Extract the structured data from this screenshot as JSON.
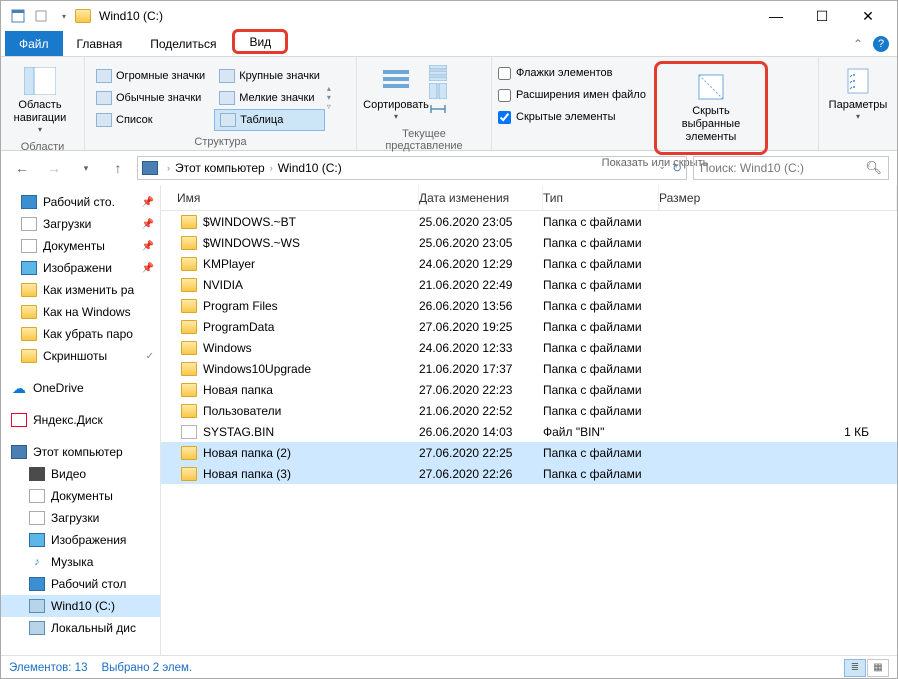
{
  "title": "Wind10 (C:)",
  "tabs": {
    "file": "Файл",
    "home": "Главная",
    "share": "Поделиться",
    "view": "Вид"
  },
  "ribbon": {
    "panes_btn": "Область навигации",
    "panes_group": "Области",
    "layout": {
      "huge": "Огромные значки",
      "large": "Крупные значки",
      "normal": "Обычные значки",
      "small": "Мелкие значки",
      "list": "Список",
      "details": "Таблица"
    },
    "layout_group": "Структура",
    "sort_btn": "Сортировать",
    "view_group": "Текущее представление",
    "chk_boxes": "Флажки элементов",
    "chk_ext": "Расширения имен файло",
    "chk_hidden": "Скрытые элементы",
    "hide_btn": "Скрыть выбранные элементы",
    "show_group": "Показать или скрыть",
    "options_btn": "Параметры"
  },
  "breadcrumb": {
    "pc": "Этот компьютер",
    "drive": "Wind10 (C:)"
  },
  "search_placeholder": "Поиск: Wind10 (C:)",
  "nav": {
    "qa": [
      {
        "label": "Рабочий сто.",
        "icon": "desk",
        "pin": true
      },
      {
        "label": "Загрузки",
        "icon": "dl",
        "pin": true
      },
      {
        "label": "Документы",
        "icon": "doc",
        "pin": true
      },
      {
        "label": "Изображени",
        "icon": "img",
        "pin": true
      },
      {
        "label": "Как изменить ра",
        "icon": "folder"
      },
      {
        "label": "Как на Windows",
        "icon": "folder"
      },
      {
        "label": "Как убрать паро",
        "icon": "folder"
      },
      {
        "label": "Скриншоты",
        "icon": "folder",
        "pin": true,
        "pinicon": "✓"
      }
    ],
    "onedrive": "OneDrive",
    "yadisk": "Яндекс.Диск",
    "thispc": "Этот компьютер",
    "pc_items": [
      {
        "label": "Видео",
        "icon": "video"
      },
      {
        "label": "Документы",
        "icon": "doc"
      },
      {
        "label": "Загрузки",
        "icon": "dl"
      },
      {
        "label": "Изображения",
        "icon": "img"
      },
      {
        "label": "Музыка",
        "icon": "music",
        "glyph": "♪"
      },
      {
        "label": "Рабочий стол",
        "icon": "desk"
      },
      {
        "label": "Wind10 (C:)",
        "icon": "drive",
        "sel": true
      },
      {
        "label": "Локальный дис",
        "icon": "drive"
      }
    ]
  },
  "columns": {
    "name": "Имя",
    "date": "Дата изменения",
    "type": "Тип",
    "size": "Размер"
  },
  "files": [
    {
      "name": "$WINDOWS.~BT",
      "date": "25.06.2020 23:05",
      "type": "Папка с файлами",
      "icon": "folder"
    },
    {
      "name": "$WINDOWS.~WS",
      "date": "25.06.2020 23:05",
      "type": "Папка с файлами",
      "icon": "folder"
    },
    {
      "name": "KMPlayer",
      "date": "24.06.2020 12:29",
      "type": "Папка с файлами",
      "icon": "folder"
    },
    {
      "name": "NVIDIA",
      "date": "21.06.2020 22:49",
      "type": "Папка с файлами",
      "icon": "folder"
    },
    {
      "name": "Program Files",
      "date": "26.06.2020 13:56",
      "type": "Папка с файлами",
      "icon": "folder"
    },
    {
      "name": "ProgramData",
      "date": "27.06.2020 19:25",
      "type": "Папка с файлами",
      "icon": "folder"
    },
    {
      "name": "Windows",
      "date": "24.06.2020 12:33",
      "type": "Папка с файлами",
      "icon": "folder"
    },
    {
      "name": "Windows10Upgrade",
      "date": "21.06.2020 17:37",
      "type": "Папка с файлами",
      "icon": "folder"
    },
    {
      "name": "Новая папка",
      "date": "27.06.2020 22:23",
      "type": "Папка с файлами",
      "icon": "folder"
    },
    {
      "name": "Пользователи",
      "date": "21.06.2020 22:52",
      "type": "Папка с файлами",
      "icon": "folder"
    },
    {
      "name": "SYSTAG.BIN",
      "date": "26.06.2020 14:03",
      "type": "Файл \"BIN\"",
      "size": "1 КБ",
      "icon": "file"
    },
    {
      "name": "Новая папка (2)",
      "date": "27.06.2020 22:25",
      "type": "Папка с файлами",
      "icon": "folder",
      "sel": true
    },
    {
      "name": "Новая папка (3)",
      "date": "27.06.2020 22:26",
      "type": "Папка с файлами",
      "icon": "folder",
      "sel": true
    }
  ],
  "status": {
    "count": "Элементов: 13",
    "selected": "Выбрано 2 элем."
  }
}
